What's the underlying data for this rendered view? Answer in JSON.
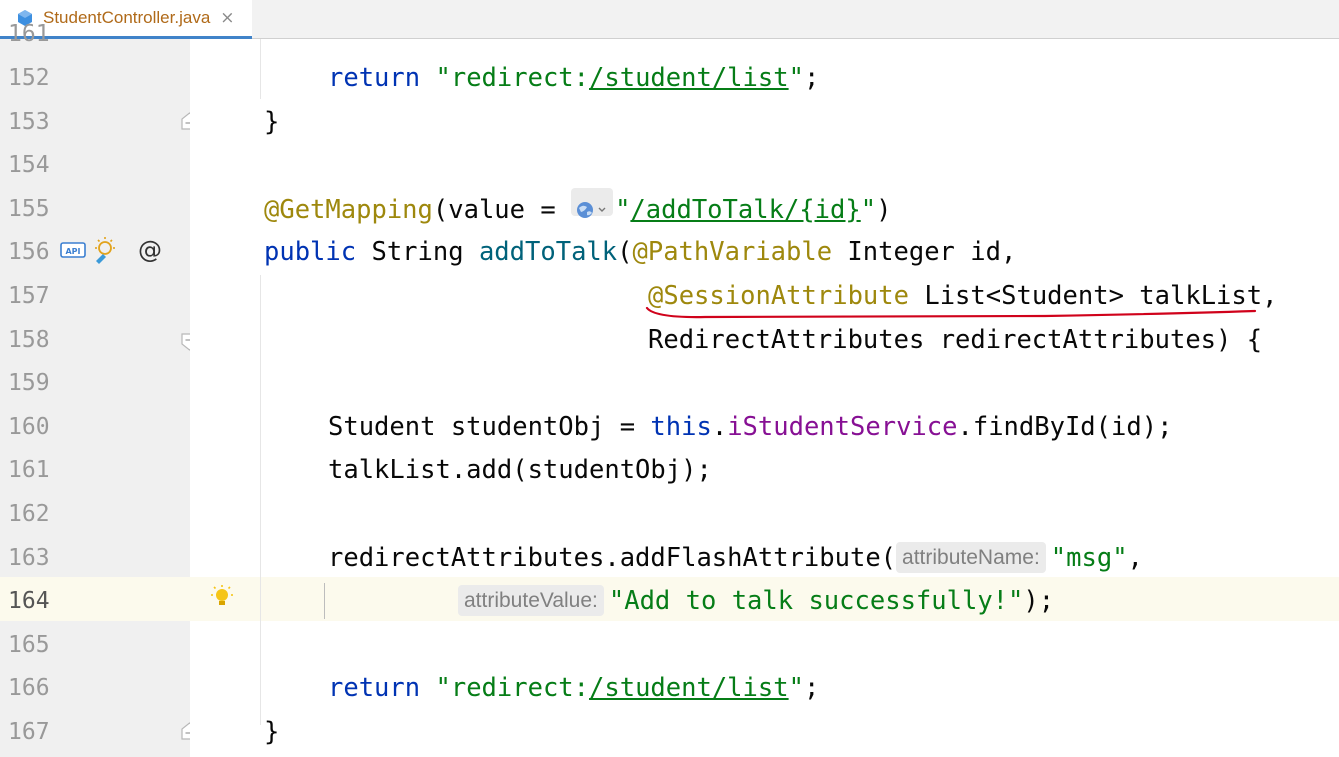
{
  "tab": {
    "title": "StudentController.java",
    "close": "×",
    "icon": "java-class-icon"
  },
  "colors": {
    "keyword": "#0033b3",
    "string": "#067d17",
    "annotation": "#9e880d",
    "field": "#871094",
    "method": "#00627a",
    "annotation_markup": "#d0021b"
  },
  "gutter": {
    "lines": [
      "161",
      "152",
      "153",
      "154",
      "155",
      "156",
      "157",
      "158",
      "159",
      "160",
      "161",
      "162",
      "163",
      "164",
      "165",
      "166",
      "167"
    ],
    "current_line": "164",
    "at_symbol": "@",
    "api_label": "API"
  },
  "code": {
    "l152": {
      "kw": "return",
      "str_q1": "\"redirect:",
      "str_path": "/student/list",
      "str_q2": "\"",
      "end": ";"
    },
    "l153": "}",
    "l155": {
      "ann": "@GetMapping",
      "open": "(value = ",
      "str_q1": "\"",
      "str_path": "/addToTalk/{id}",
      "str_q2": "\"",
      "close": ")"
    },
    "l156": {
      "kw": "public",
      "type": " String ",
      "method": "addToTalk",
      "open": "(",
      "ann": "@PathVariable",
      "rest": " Integer id,"
    },
    "l157": {
      "ann": "@SessionAttribute",
      "rest": " List<Student> talkList,"
    },
    "l158": "RedirectAttributes redirectAttributes) {",
    "l160": {
      "pre": "Student studentObj = ",
      "kw": "this",
      "dot": ".",
      "field": "iStudentService",
      "rest": ".findById(id);"
    },
    "l161": "talkList.add(studentObj);",
    "l163": {
      "pre": "redirectAttributes.addFlashAttribute(",
      "hint": "attributeName:",
      "str": "\"msg\"",
      "end": ","
    },
    "l164": {
      "hint": "attributeValue:",
      "str": "\"Add to talk successfully!\"",
      "end": ");"
    },
    "l166": {
      "kw": "return",
      "str_q1": "\"redirect:",
      "str_path": "/student/list",
      "str_q2": "\"",
      "end": ";"
    },
    "l167": "}"
  }
}
